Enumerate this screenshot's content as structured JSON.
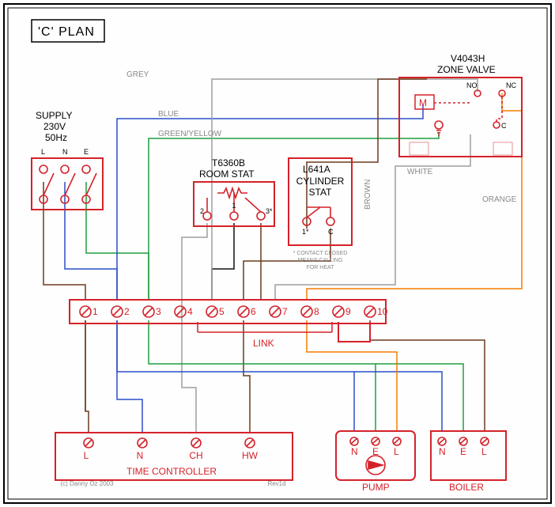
{
  "title": "'C' PLAN",
  "supply": {
    "label": "SUPPLY",
    "voltage": "230V",
    "freq": "50Hz",
    "terms": [
      "L",
      "N",
      "E"
    ]
  },
  "room_stat": {
    "model": "T6360B",
    "name": "ROOM STAT",
    "terms": [
      "2",
      "1",
      "3*"
    ]
  },
  "cyl_stat": {
    "model": "L641A",
    "name1": "CYLINDER",
    "name2": "STAT",
    "terms": [
      "1*",
      "C"
    ],
    "note1": "* CONTACT CLOSED",
    "note2": "MEANS CALLING",
    "note3": "FOR HEAT"
  },
  "zone_valve": {
    "model": "V4043H",
    "name": "ZONE VALVE",
    "m": "M",
    "no": "NO",
    "nc": "NC",
    "c": "C",
    "ground": "⏚",
    "arrow": "↺"
  },
  "junction": {
    "link": "LINK",
    "terms": [
      "1",
      "2",
      "3",
      "4",
      "5",
      "6",
      "7",
      "8",
      "9",
      "10"
    ]
  },
  "time_ctrl": {
    "name": "TIME CONTROLLER",
    "terms": [
      "L",
      "N",
      "CH",
      "HW"
    ]
  },
  "pump": {
    "name": "PUMP",
    "terms": [
      "N",
      "E",
      "L"
    ]
  },
  "boiler": {
    "name": "BOILER",
    "terms": [
      "N",
      "E",
      "L"
    ]
  },
  "wires": {
    "grey": "GREY",
    "blue": "BLUE",
    "gy": "GREEN/YELLOW",
    "brown": "BROWN",
    "white": "WHITE",
    "orange": "ORANGE"
  },
  "footer": {
    "copyright": "(c) Danny Oz 2003",
    "rev": "Rev1d"
  },
  "colors": {
    "red": "#D4222A",
    "blue": "#2A4FC8",
    "green": "#1E9E3E",
    "brown": "#6B3A1F",
    "grey": "#9E9E9E",
    "orange": "#F57C00",
    "black": "#111"
  }
}
